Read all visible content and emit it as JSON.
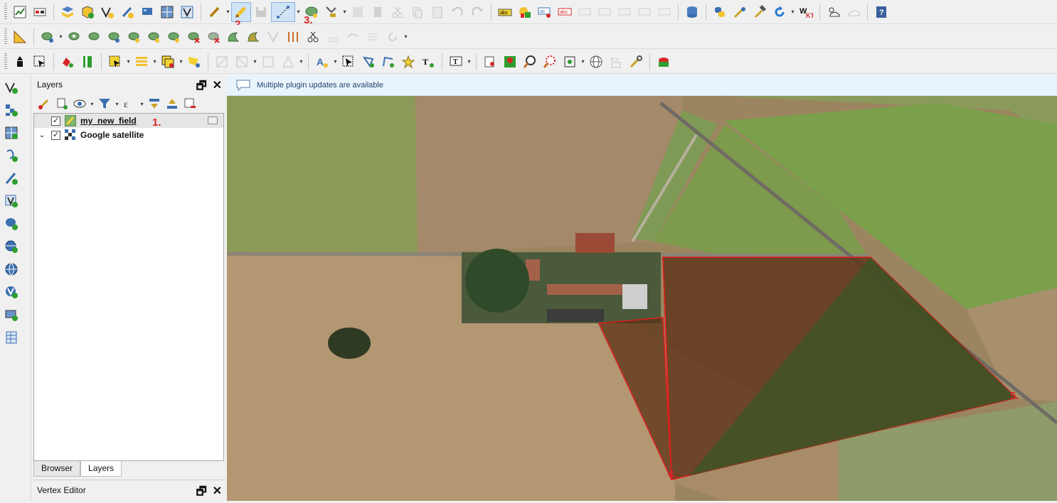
{
  "toolbars": {
    "row1_icons": [
      "project-new-icon",
      "layout-manager-icon",
      "open-data-source-manager-icon",
      "new-geopackage-icon",
      "add-vector-layer-icon",
      "add-raster-layer-icon",
      "add-delimited-text-icon",
      "current-edits-icon",
      "toggle-editing-icon",
      "save-edits-icon",
      "digitize-line-icon",
      "add-polygon-icon",
      "vertex-tool-icon",
      "modify-attributes-icon",
      "delete-selected-icon",
      "cut-features-icon",
      "copy-features-icon",
      "paste-features-icon",
      "undo-icon",
      "redo-icon",
      "label-toolbar-icon",
      "diagram-toolbar-icon",
      "pin-labels-icon",
      "highlight-labels-icon",
      "db-manager-icon",
      "python-console-icon",
      "plugin-icon",
      "wkt-icon",
      "weather-icon",
      "help-icon"
    ],
    "row2_icons": [
      "digitize-with-segment-icon",
      "add-ring-icon",
      "add-part-icon",
      "fill-ring-icon",
      "delete-ring-icon",
      "delete-part-icon",
      "reshape-icon",
      "offset-curve-icon",
      "split-features-icon",
      "split-parts-icon",
      "merge-features-icon",
      "rotate-point-symbols-icon",
      "simplify-icon",
      "trim-extend-icon"
    ],
    "row3_icons": [
      "identify-icon",
      "select-by-area-icon",
      "deselect-icon",
      "open-attribute-table-icon",
      "field-calculator-icon",
      "statistics-icon",
      "measure-icon",
      "annotation-icon",
      "label-tool-icon",
      "text-annotation-icon",
      "map-tip-icon",
      "zoom-in-icon",
      "zoom-out-icon",
      "zoom-full-icon",
      "globe-icon",
      "coordinate-capture-icon",
      "settings-wrench-icon",
      "plugin-field-icon"
    ]
  },
  "annotations": {
    "label_1": "1.",
    "label_2": "2.",
    "label_3": "3.",
    "label_4": "4.",
    "label_5": "5."
  },
  "layers_panel": {
    "title": "Layers",
    "layers": [
      {
        "name": "my_new_field",
        "checked": true,
        "type": "vector-polygon",
        "editing": true
      },
      {
        "name": "Google satellite",
        "checked": true,
        "type": "raster"
      }
    ],
    "tabs": [
      "Browser",
      "Layers"
    ],
    "active_tab": "Layers"
  },
  "vertex_panel": {
    "title": "Vertex Editor"
  },
  "message_bar": {
    "text": "Multiple plugin updates are available"
  },
  "colors": {
    "polygon_fill": "#6b3f1f",
    "polygon_stroke": "#e11d1d",
    "annotation_red": "#d62828",
    "message_bg": "#e9f3fc"
  }
}
